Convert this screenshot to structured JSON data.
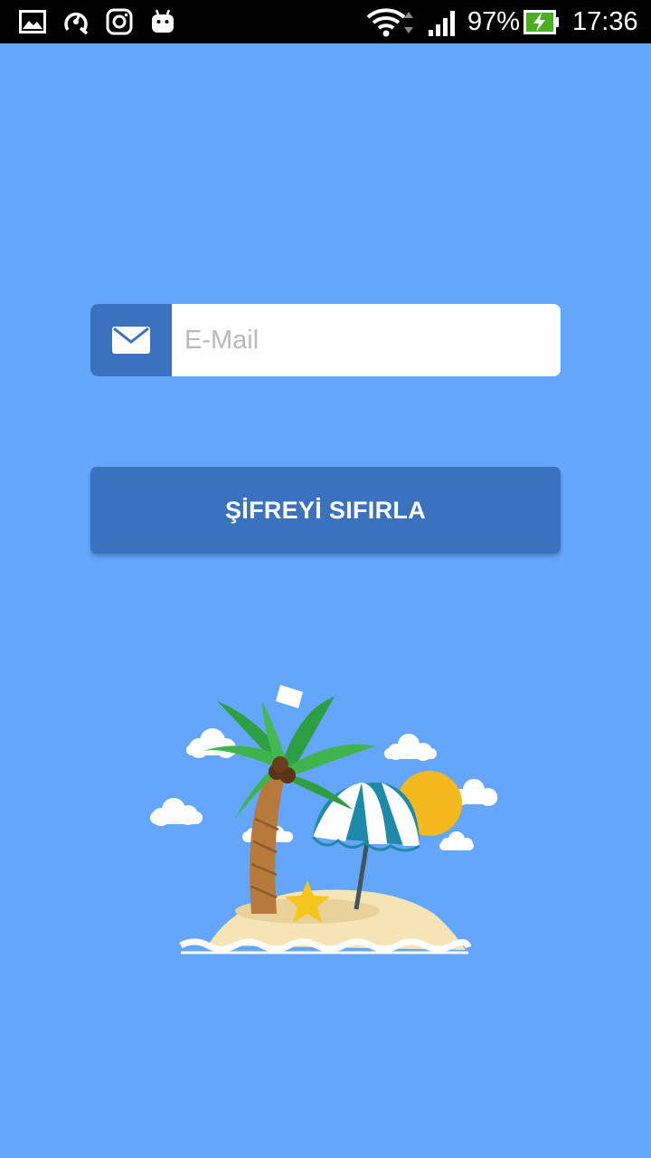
{
  "status_bar": {
    "battery_percent": "97%",
    "time": "17:36",
    "icons": [
      "gallery-icon",
      "speedometer-icon",
      "instagram-icon",
      "android-icon",
      "wifi-icon",
      "signal-icon",
      "battery-charging-icon"
    ]
  },
  "form": {
    "email_placeholder": "E-Mail",
    "email_value": "",
    "reset_button_label": "ŞİFREYİ SIFIRLA"
  },
  "colors": {
    "background": "#63a6fc",
    "accent": "#3a72bd"
  },
  "illustration": "beach-island-illustration"
}
